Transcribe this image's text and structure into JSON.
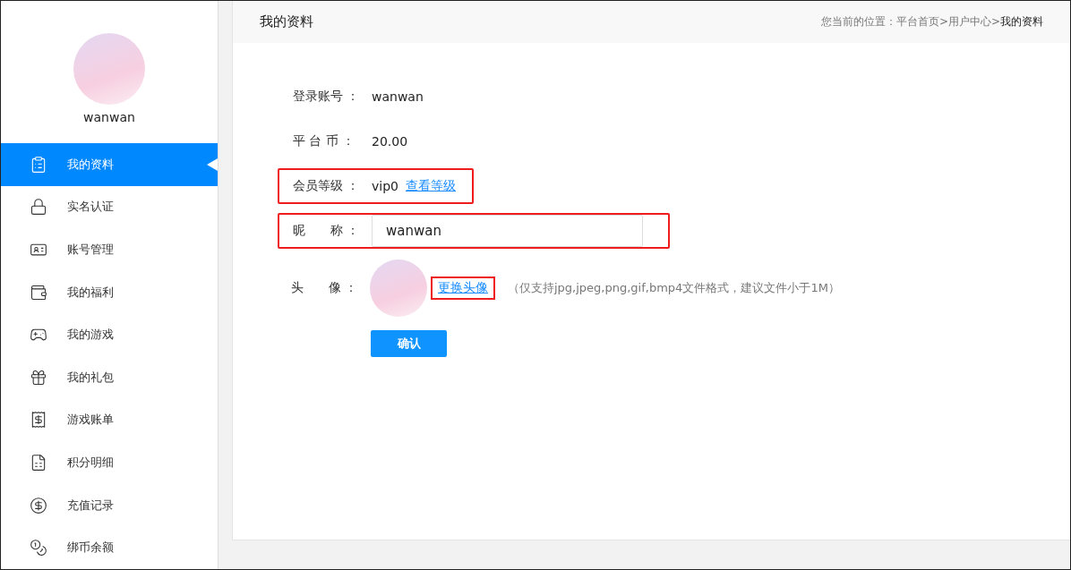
{
  "sidebar": {
    "username": "wanwan",
    "items": [
      {
        "label": "我的资料",
        "selected": true
      },
      {
        "label": "实名认证",
        "selected": false
      },
      {
        "label": "账号管理",
        "selected": false
      },
      {
        "label": "我的福利",
        "selected": false
      },
      {
        "label": "我的游戏",
        "selected": false
      },
      {
        "label": "我的礼包",
        "selected": false
      },
      {
        "label": "游戏账单",
        "selected": false
      },
      {
        "label": "积分明细",
        "selected": false
      },
      {
        "label": "充值记录",
        "selected": false
      },
      {
        "label": "绑币余额",
        "selected": false
      }
    ]
  },
  "header": {
    "title": "我的资料",
    "breadcrumb": {
      "prefix": "您当前的位置：",
      "links": [
        "平台首页>",
        "用户中心>"
      ],
      "current": "我的资料"
    }
  },
  "form": {
    "rows": [
      {
        "kind": "text",
        "label": "登录账号 ：",
        "value": "wanwan",
        "highlighted": false
      },
      {
        "kind": "text",
        "label": "平 台 币 ：",
        "value": "20.00",
        "highlighted": false
      },
      {
        "kind": "level",
        "label": "会员等级 ：",
        "value": "vip0",
        "link": "查看等级",
        "highlighted": true
      },
      {
        "kind": "input",
        "label": "昵　　称 ：",
        "value": "wanwan",
        "highlighted": true
      },
      {
        "kind": "avatar",
        "label": "头　　像 ：",
        "link": "更换头像",
        "hint": "（仅支持jpg,jpeg,png,gif,bmp4文件格式，建议文件小于1M）",
        "highlighted": true
      }
    ],
    "submit": "确认"
  }
}
